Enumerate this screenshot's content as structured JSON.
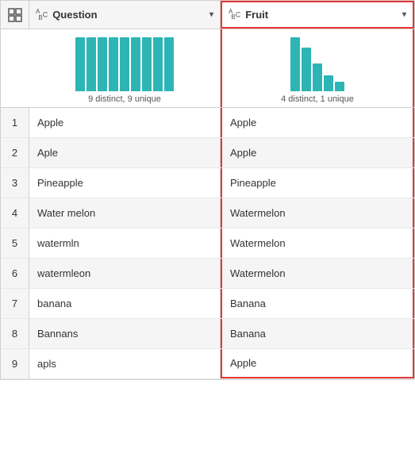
{
  "header": {
    "grid_icon": "grid",
    "col1": {
      "type_icon": "ABC",
      "label": "Question",
      "dropdown": "▾"
    },
    "col2": {
      "type_icon": "ABC",
      "label": "Fruit",
      "dropdown": "▾"
    }
  },
  "histogram": {
    "col1": {
      "label": "9 distinct, 9 unique",
      "bars": [
        68,
        68,
        68,
        68,
        68,
        68,
        68,
        68,
        68
      ]
    },
    "col2": {
      "label": "4 distinct, 1 unique",
      "bars": [
        68,
        55,
        35,
        20,
        12
      ]
    }
  },
  "rows": [
    {
      "num": "1",
      "question": "Apple",
      "fruit": "Apple"
    },
    {
      "num": "2",
      "question": "Aple",
      "fruit": "Apple"
    },
    {
      "num": "3",
      "question": "Pineapple",
      "fruit": "Pineapple"
    },
    {
      "num": "4",
      "question": "Water melon",
      "fruit": "Watermelon"
    },
    {
      "num": "5",
      "question": "watermln",
      "fruit": "Watermelon"
    },
    {
      "num": "6",
      "question": "watermleon",
      "fruit": "Watermelon"
    },
    {
      "num": "7",
      "question": "banana",
      "fruit": "Banana"
    },
    {
      "num": "8",
      "question": "Bannans",
      "fruit": "Banana"
    },
    {
      "num": "9",
      "question": "apls",
      "fruit": "Apple"
    }
  ]
}
